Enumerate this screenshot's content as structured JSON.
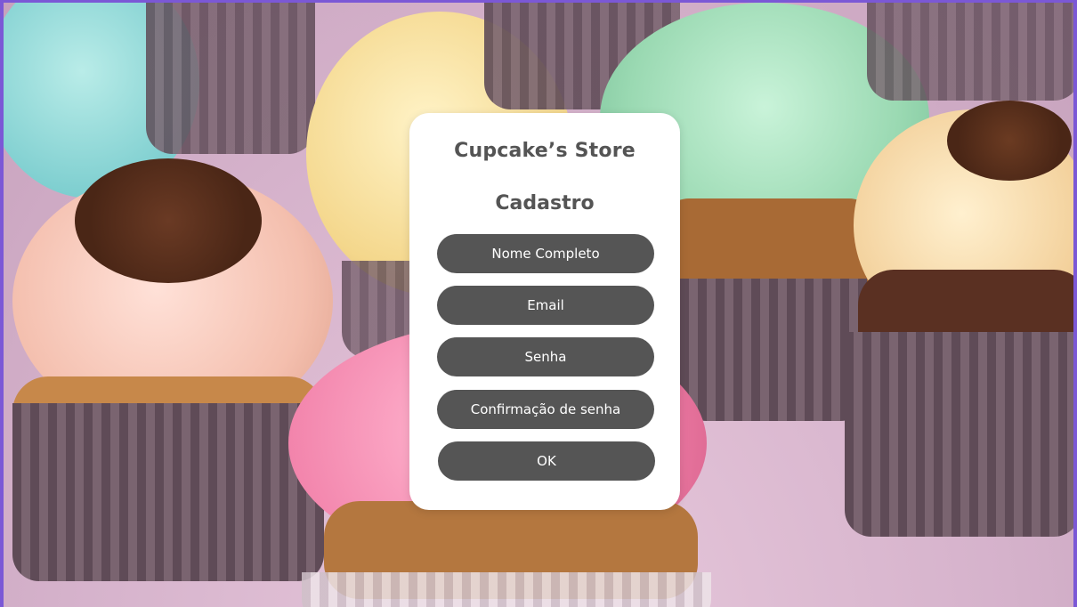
{
  "store": {
    "title": "Cupcake’s Store",
    "subtitle": "Cadastro"
  },
  "form": {
    "name_field": "Nome Completo",
    "email_field": "Email",
    "password_field": "Senha",
    "confirm_password_field": "Confirmação de senha",
    "ok_button": "OK"
  },
  "colors": {
    "frame_border": "#7b58d6",
    "card_background": "#ffffff",
    "pill_background": "#555555",
    "title_text": "#545454"
  }
}
